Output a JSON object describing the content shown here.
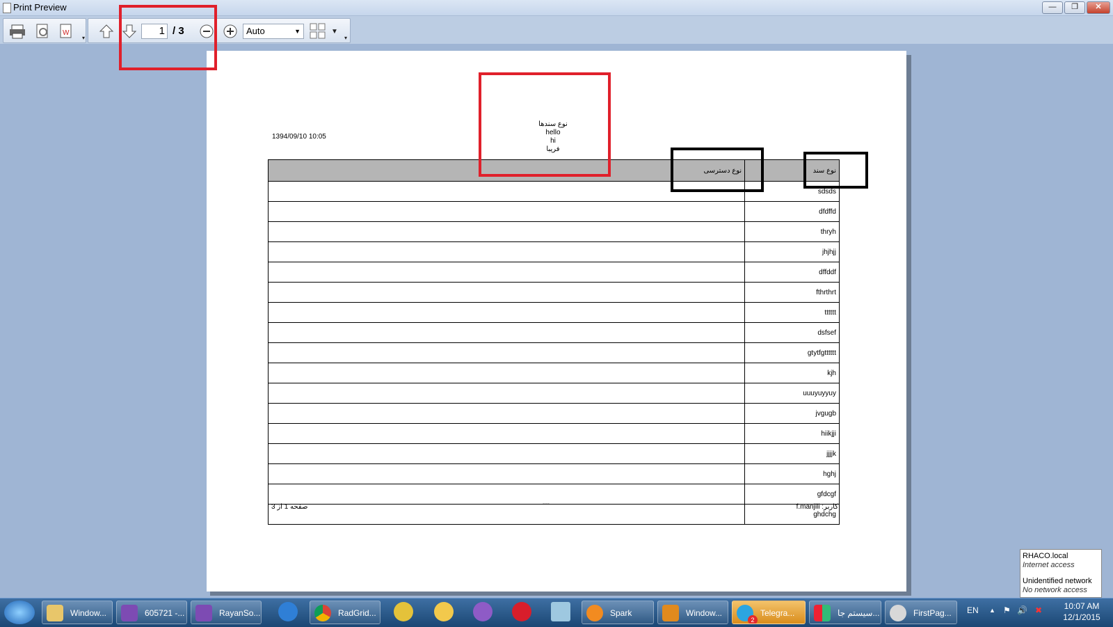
{
  "window": {
    "title": "Print Preview",
    "min_label": "—",
    "max_label": "❐",
    "close_label": "✕"
  },
  "toolbar": {
    "page_current": "1",
    "page_total": "/ 3",
    "zoom_value": "Auto"
  },
  "report": {
    "date": "1394/09/10 10:05",
    "header_lines": [
      "نوع سندها",
      "hello",
      "hi",
      "فریبا"
    ],
    "columns": [
      "نوع دسترسی",
      "نوع سند"
    ],
    "rows": [
      [
        "",
        "sdsds"
      ],
      [
        "",
        "dfdffd"
      ],
      [
        "",
        "thryh"
      ],
      [
        "",
        "jhjhjj"
      ],
      [
        "",
        "dffddf"
      ],
      [
        "",
        "fthrthrt"
      ],
      [
        "",
        "tttttt"
      ],
      [
        "",
        "dsfsef"
      ],
      [
        "",
        "gtytfgtttttt"
      ],
      [
        "",
        "kjh"
      ],
      [
        "",
        "uuuyuyyuy"
      ],
      [
        "",
        "jvgugb"
      ],
      [
        "",
        "hiikjji"
      ],
      [
        "",
        "jjjjk"
      ],
      [
        "",
        "hghj"
      ],
      [
        "",
        "gfdcgf"
      ],
      [
        "",
        "ghdchg"
      ]
    ],
    "footer_left": "صفحه 1 از 3",
    "footer_center": "---",
    "footer_right": "کاربر: f.manjili"
  },
  "notification": {
    "net1_name": "RHACO.local",
    "net1_status": "Internet access",
    "net2_name": "Unidentified network",
    "net2_status": "No network access"
  },
  "taskbar": {
    "items": [
      "Window...",
      "605721 -...",
      "RayanSo...",
      "RadGrid...",
      "Spark",
      "Window...",
      "Telegra...",
      "سیستم جا...",
      "FirstPag..."
    ],
    "telegram_badge": "2",
    "language": "EN",
    "time": "10:07 AM",
    "date": "12/1/2015"
  },
  "colors": {
    "annotation_red": "#e0202b",
    "annotation_black": "#000000",
    "header_gray": "#b5b5b5"
  }
}
